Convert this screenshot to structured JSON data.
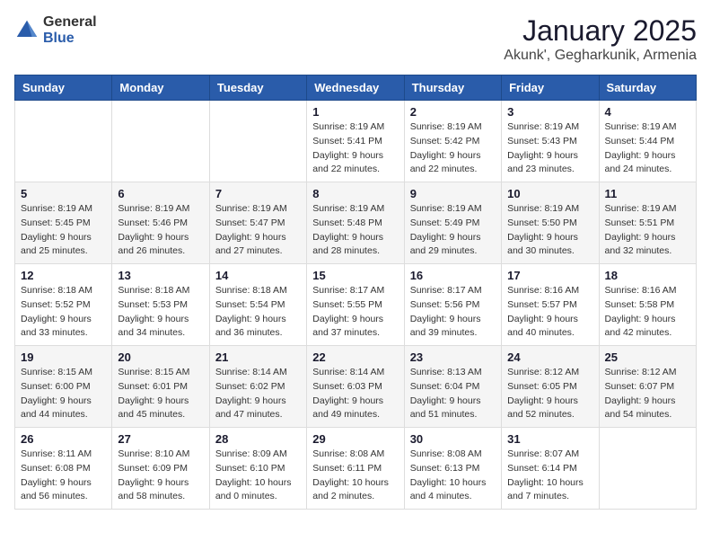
{
  "header": {
    "logo_general": "General",
    "logo_blue": "Blue",
    "month_title": "January 2025",
    "location": "Akunk', Gegharkunik, Armenia"
  },
  "weekdays": [
    "Sunday",
    "Monday",
    "Tuesday",
    "Wednesday",
    "Thursday",
    "Friday",
    "Saturday"
  ],
  "weeks": [
    [
      {
        "day": "",
        "info": ""
      },
      {
        "day": "",
        "info": ""
      },
      {
        "day": "",
        "info": ""
      },
      {
        "day": "1",
        "info": "Sunrise: 8:19 AM\nSunset: 5:41 PM\nDaylight: 9 hours\nand 22 minutes."
      },
      {
        "day": "2",
        "info": "Sunrise: 8:19 AM\nSunset: 5:42 PM\nDaylight: 9 hours\nand 22 minutes."
      },
      {
        "day": "3",
        "info": "Sunrise: 8:19 AM\nSunset: 5:43 PM\nDaylight: 9 hours\nand 23 minutes."
      },
      {
        "day": "4",
        "info": "Sunrise: 8:19 AM\nSunset: 5:44 PM\nDaylight: 9 hours\nand 24 minutes."
      }
    ],
    [
      {
        "day": "5",
        "info": "Sunrise: 8:19 AM\nSunset: 5:45 PM\nDaylight: 9 hours\nand 25 minutes."
      },
      {
        "day": "6",
        "info": "Sunrise: 8:19 AM\nSunset: 5:46 PM\nDaylight: 9 hours\nand 26 minutes."
      },
      {
        "day": "7",
        "info": "Sunrise: 8:19 AM\nSunset: 5:47 PM\nDaylight: 9 hours\nand 27 minutes."
      },
      {
        "day": "8",
        "info": "Sunrise: 8:19 AM\nSunset: 5:48 PM\nDaylight: 9 hours\nand 28 minutes."
      },
      {
        "day": "9",
        "info": "Sunrise: 8:19 AM\nSunset: 5:49 PM\nDaylight: 9 hours\nand 29 minutes."
      },
      {
        "day": "10",
        "info": "Sunrise: 8:19 AM\nSunset: 5:50 PM\nDaylight: 9 hours\nand 30 minutes."
      },
      {
        "day": "11",
        "info": "Sunrise: 8:19 AM\nSunset: 5:51 PM\nDaylight: 9 hours\nand 32 minutes."
      }
    ],
    [
      {
        "day": "12",
        "info": "Sunrise: 8:18 AM\nSunset: 5:52 PM\nDaylight: 9 hours\nand 33 minutes."
      },
      {
        "day": "13",
        "info": "Sunrise: 8:18 AM\nSunset: 5:53 PM\nDaylight: 9 hours\nand 34 minutes."
      },
      {
        "day": "14",
        "info": "Sunrise: 8:18 AM\nSunset: 5:54 PM\nDaylight: 9 hours\nand 36 minutes."
      },
      {
        "day": "15",
        "info": "Sunrise: 8:17 AM\nSunset: 5:55 PM\nDaylight: 9 hours\nand 37 minutes."
      },
      {
        "day": "16",
        "info": "Sunrise: 8:17 AM\nSunset: 5:56 PM\nDaylight: 9 hours\nand 39 minutes."
      },
      {
        "day": "17",
        "info": "Sunrise: 8:16 AM\nSunset: 5:57 PM\nDaylight: 9 hours\nand 40 minutes."
      },
      {
        "day": "18",
        "info": "Sunrise: 8:16 AM\nSunset: 5:58 PM\nDaylight: 9 hours\nand 42 minutes."
      }
    ],
    [
      {
        "day": "19",
        "info": "Sunrise: 8:15 AM\nSunset: 6:00 PM\nDaylight: 9 hours\nand 44 minutes."
      },
      {
        "day": "20",
        "info": "Sunrise: 8:15 AM\nSunset: 6:01 PM\nDaylight: 9 hours\nand 45 minutes."
      },
      {
        "day": "21",
        "info": "Sunrise: 8:14 AM\nSunset: 6:02 PM\nDaylight: 9 hours\nand 47 minutes."
      },
      {
        "day": "22",
        "info": "Sunrise: 8:14 AM\nSunset: 6:03 PM\nDaylight: 9 hours\nand 49 minutes."
      },
      {
        "day": "23",
        "info": "Sunrise: 8:13 AM\nSunset: 6:04 PM\nDaylight: 9 hours\nand 51 minutes."
      },
      {
        "day": "24",
        "info": "Sunrise: 8:12 AM\nSunset: 6:05 PM\nDaylight: 9 hours\nand 52 minutes."
      },
      {
        "day": "25",
        "info": "Sunrise: 8:12 AM\nSunset: 6:07 PM\nDaylight: 9 hours\nand 54 minutes."
      }
    ],
    [
      {
        "day": "26",
        "info": "Sunrise: 8:11 AM\nSunset: 6:08 PM\nDaylight: 9 hours\nand 56 minutes."
      },
      {
        "day": "27",
        "info": "Sunrise: 8:10 AM\nSunset: 6:09 PM\nDaylight: 9 hours\nand 58 minutes."
      },
      {
        "day": "28",
        "info": "Sunrise: 8:09 AM\nSunset: 6:10 PM\nDaylight: 10 hours\nand 0 minutes."
      },
      {
        "day": "29",
        "info": "Sunrise: 8:08 AM\nSunset: 6:11 PM\nDaylight: 10 hours\nand 2 minutes."
      },
      {
        "day": "30",
        "info": "Sunrise: 8:08 AM\nSunset: 6:13 PM\nDaylight: 10 hours\nand 4 minutes."
      },
      {
        "day": "31",
        "info": "Sunrise: 8:07 AM\nSunset: 6:14 PM\nDaylight: 10 hours\nand 7 minutes."
      },
      {
        "day": "",
        "info": ""
      }
    ]
  ]
}
